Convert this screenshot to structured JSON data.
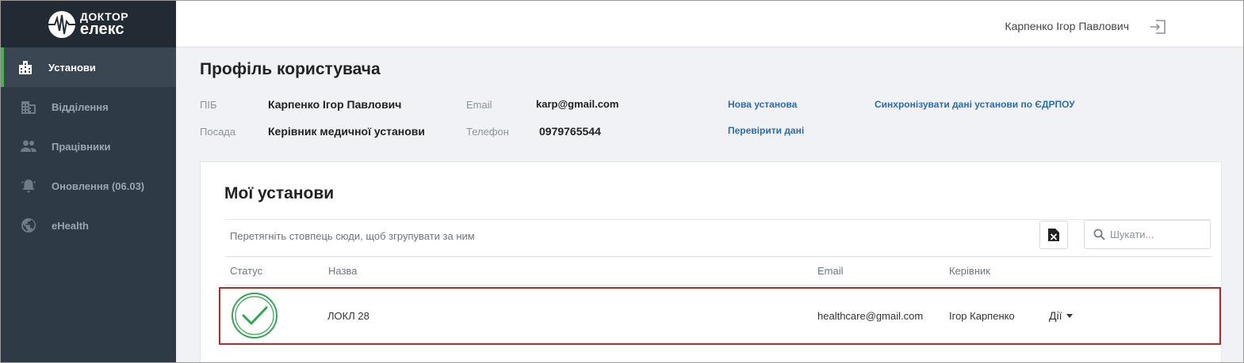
{
  "brand": {
    "line1": "ДОКТОР",
    "line2": "елекс"
  },
  "sidebar": {
    "items": [
      {
        "label": "Установи",
        "icon": "buildings-icon",
        "active": true
      },
      {
        "label": "Відділення",
        "icon": "building-grid-icon",
        "active": false
      },
      {
        "label": "Працівники",
        "icon": "people-icon",
        "active": false
      },
      {
        "label": "Оновлення (06.03)",
        "icon": "bell-icon",
        "active": false
      },
      {
        "label": "eHealth",
        "icon": "globe-icon",
        "active": false
      }
    ]
  },
  "header": {
    "user_name": "Карпенко Ігор Павлович",
    "logout_icon": "logout-icon"
  },
  "profile": {
    "title": "Профіль користувача",
    "pib_label": "ПІБ",
    "pib_value": "Карпенко Ігор Павлович",
    "position_label": "Посада",
    "position_value": "Керівник медичної установи",
    "email_label": "Email",
    "email_value": "karp@gmail.com",
    "phone_label": "Телефон",
    "phone_value": "0979765544",
    "link_new": "Нова установа",
    "link_check": "Перевірити дані",
    "link_sync": "Синхронізувати дані установи по ЄДРПОУ"
  },
  "institutions": {
    "title": "Мої установи",
    "group_hint": "Перетягніть стовпець сюди, щоб згрупувати за ним",
    "search_placeholder": "Шукати...",
    "columns": {
      "status": "Статус",
      "name": "Назва",
      "email": "Email",
      "manager": "Керівник"
    },
    "rows": [
      {
        "status": "approved",
        "name": "ЛОКЛ 28",
        "email": "healthcare@gmail.com",
        "manager": "Ігор Карпенко",
        "actions": "Дії"
      }
    ]
  },
  "colors": {
    "accent": "#4caf50",
    "sidebar_bg": "#2e3a45",
    "link": "#2b6cb0",
    "highlight": "#b82a2a",
    "status_ok": "#2fa84f"
  }
}
